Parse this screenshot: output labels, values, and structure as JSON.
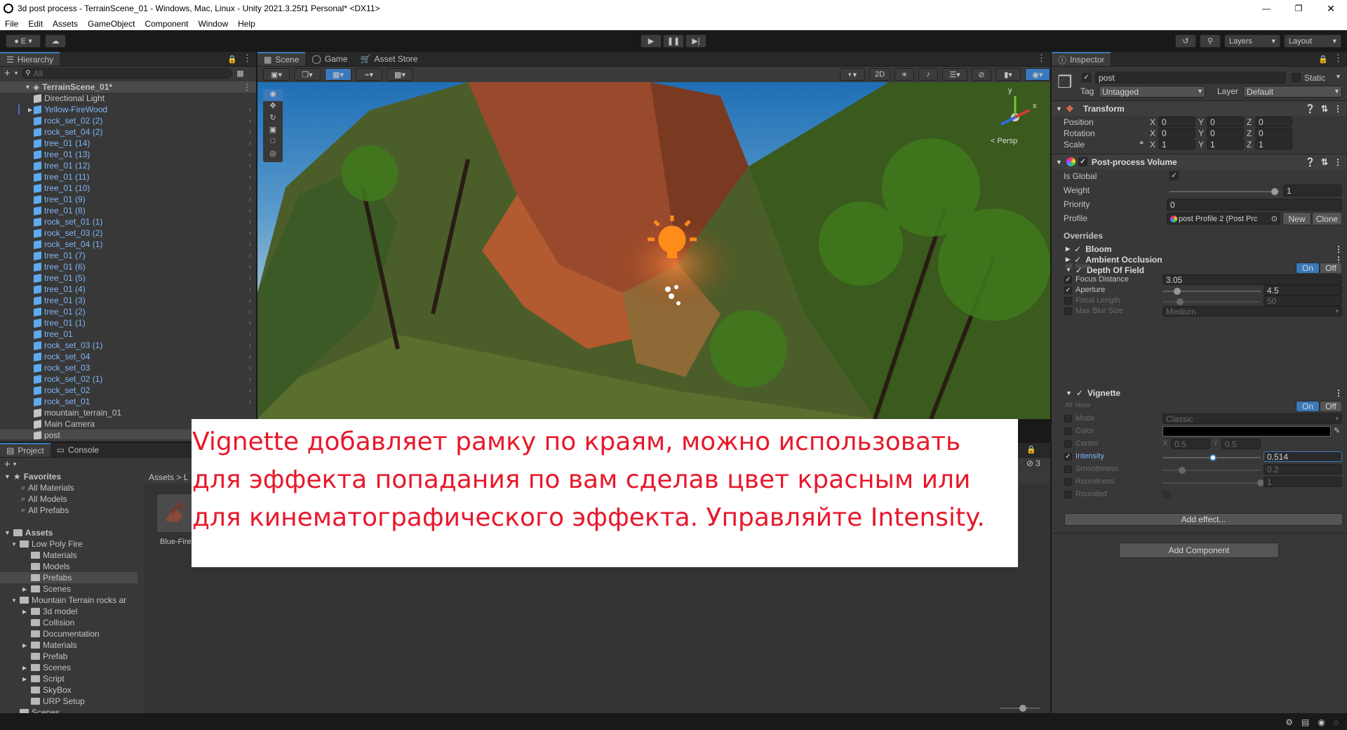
{
  "window": {
    "title": "3d post process - TerrainScene_01 - Windows, Mac, Linux - Unity 2021.3.25f1 Personal* <DX11>"
  },
  "menu": [
    "File",
    "Edit",
    "Assets",
    "GameObject",
    "Component",
    "Window",
    "Help"
  ],
  "toolbar": {
    "account": "E",
    "layers_label": "Layers",
    "layout_label": "Layout"
  },
  "hierarchy": {
    "tab": "Hierarchy",
    "search_placeholder": "All",
    "scene": "TerrainScene_01*",
    "items": [
      "Directional Light",
      "Yellow-FireWood",
      "rock_set_02 (2)",
      "rock_set_04 (2)",
      "tree_01 (14)",
      "tree_01 (13)",
      "tree_01 (12)",
      "tree_01 (11)",
      "tree_01 (10)",
      "tree_01 (9)",
      "tree_01 (8)",
      "rock_set_01 (1)",
      "rock_set_03 (2)",
      "rock_set_04 (1)",
      "tree_01 (7)",
      "tree_01 (6)",
      "tree_01 (5)",
      "tree_01 (4)",
      "tree_01 (3)",
      "tree_01 (2)",
      "tree_01 (1)",
      "tree_01",
      "rock_set_03 (1)",
      "rock_set_04",
      "rock_set_03",
      "rock_set_02 (1)",
      "rock_set_02",
      "rock_set_01",
      "mountain_terrain_01",
      "Main Camera",
      "post"
    ]
  },
  "scene_tabs": [
    "Scene",
    "Game",
    "Asset Store"
  ],
  "scene_view": {
    "mode_2d": "2D",
    "persp_label": "< Persp",
    "gizmo_y": "y",
    "gizmo_x": "x"
  },
  "project": {
    "tabs": [
      "Project",
      "Console"
    ],
    "favorites_label": "Favorites",
    "favorites": [
      "All Materials",
      "All Models",
      "All Prefabs"
    ],
    "assets_label": "Assets",
    "tree": [
      {
        "label": "Low Poly Fire",
        "depth": 1,
        "open": true
      },
      {
        "label": "Materials",
        "depth": 2
      },
      {
        "label": "Models",
        "depth": 2
      },
      {
        "label": "Prefabs",
        "depth": 2,
        "selected": true
      },
      {
        "label": "Scenes",
        "depth": 2,
        "arrow": true
      },
      {
        "label": "Mountain Terrain rocks ar",
        "depth": 1,
        "open": true
      },
      {
        "label": "3d model",
        "depth": 2,
        "arrow": true
      },
      {
        "label": "Collision",
        "depth": 2
      },
      {
        "label": "Documentation",
        "depth": 2
      },
      {
        "label": "Materials",
        "depth": 2,
        "arrow": true
      },
      {
        "label": "Prefab",
        "depth": 2
      },
      {
        "label": "Scenes",
        "depth": 2,
        "arrow": true
      },
      {
        "label": "Script",
        "depth": 2,
        "arrow": true
      },
      {
        "label": "SkyBox",
        "depth": 2
      },
      {
        "label": "URP Setup",
        "depth": 2
      },
      {
        "label": "Scenes",
        "depth": 1
      }
    ],
    "breadcrumb": "Assets > L",
    "asset_item": "Blue-Fire",
    "hidden_count": "3"
  },
  "inspector": {
    "tab": "Inspector",
    "object_name": "post",
    "static_label": "Static",
    "tag_label": "Tag",
    "tag_value": "Untagged",
    "layer_label": "Layer",
    "layer_value": "Default",
    "transform": {
      "title": "Transform",
      "rows": [
        {
          "label": "Position",
          "x": "0",
          "y": "0",
          "z": "0"
        },
        {
          "label": "Rotation",
          "x": "0",
          "y": "0",
          "z": "0"
        },
        {
          "label": "Scale",
          "x": "1",
          "y": "1",
          "z": "1"
        }
      ]
    },
    "volume": {
      "title": "Post-process Volume",
      "is_global_label": "Is Global",
      "weight_label": "Weight",
      "weight": "1",
      "weight_fraction": 1.0,
      "priority_label": "Priority",
      "priority": "0",
      "profile_label": "Profile",
      "profile_value": "post Profile 2 (Post Prc",
      "new_btn": "New",
      "clone_btn": "Clone",
      "overrides_label": "Overrides",
      "effects": [
        "Bloom",
        "Ambient Occlusion",
        "Depth Of Field"
      ],
      "all_label": "All",
      "none_label": "None",
      "on_label": "On",
      "off_label": "Off",
      "dof": [
        {
          "label": "Focus Distance",
          "value": "3.05",
          "checked": true
        },
        {
          "label": "Aperture",
          "value": "4.5",
          "checked": true,
          "slider": 0.15
        },
        {
          "label": "Focal Length",
          "value": "50",
          "checked": false,
          "slider": 0.18
        },
        {
          "label": "Max Blur Size",
          "value": "Medium",
          "checked": false
        }
      ],
      "vignette_title": "Vignette",
      "vignette": [
        {
          "label": "Mode",
          "value": "Classic"
        },
        {
          "label": "Color",
          "value": ""
        },
        {
          "label": "Center",
          "x": "0.5",
          "y": "0.5"
        },
        {
          "label": "Intensity",
          "value": "0.514",
          "slider": 0.514,
          "checked": true
        },
        {
          "label": "Smoothness",
          "value": "0.2",
          "slider": 0.2
        },
        {
          "label": "Roundness",
          "value": "1",
          "slider": 1.0
        },
        {
          "label": "Rounded",
          "value": ""
        }
      ],
      "add_effect": "Add effect..."
    },
    "add_component": "Add Component"
  },
  "overlay": {
    "text": "Vignette добавляет рамку по краям, можно использовать для эффекта попадания по вам сделав цвет красным или для кинематографического эффекта. Управляйте Intensity."
  },
  "colors": {
    "accent": "#3a79bb",
    "overlay_text": "#e8182b",
    "panel": "#383838"
  }
}
